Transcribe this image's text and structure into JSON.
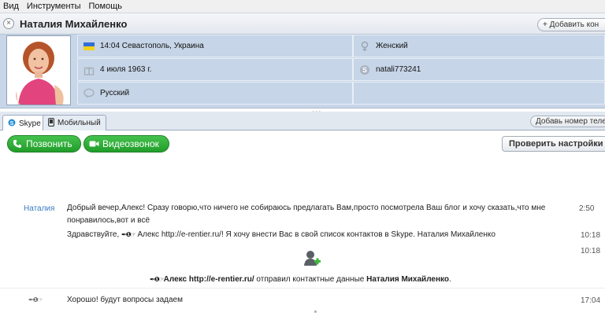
{
  "menu": {
    "items": [
      "Вид",
      "Инструменты",
      "Помощь"
    ]
  },
  "header": {
    "close_symbol": "×",
    "contact_name": "Наталия Михайленко",
    "add_contact_label": "+ Добавить кон"
  },
  "profile": {
    "local_time": "14:04 Севастополь, Украина",
    "birthday": "4 июля 1963 г.",
    "language": "Русский",
    "gender": "Женский",
    "skype_name": "natali773241",
    "flag_colors": {
      "top": "#2f6fd6",
      "bottom": "#f5d21a"
    }
  },
  "tabs": [
    {
      "label": "Skype",
      "icon": "skype-icon",
      "active": true
    },
    {
      "label": "Мобильный",
      "icon": "mobile-phone-icon",
      "active": false
    }
  ],
  "add_phone_label": "Добавь номер теле",
  "toolbar": {
    "call_label": "Позвонить",
    "video_label": "Видеозвонок",
    "check_settings_label": "Проверить настройки",
    "accent": "#2aa233"
  },
  "chat": {
    "messages": [
      {
        "sender": "Наталия",
        "text_line1": "Добрый вечер,Алекс! Сразу говорю,что ничего не собираюсь предлагать Вам,просто посмотрела Ваш блог и хочу сказать,что мне",
        "text_line2": "понравилось,вот и всё",
        "time": "2:50"
      },
      {
        "text_prefix": "Здравствуйте, ",
        "nick": "✒❶☞",
        "text_rest": " Алекс http://e-rentier.ru/! Я хочу внести Вас в свой список контактов в Skype. Наталия Михайленко",
        "time": "10:18"
      },
      {
        "time": "10:18",
        "nick": "✒❶☞",
        "sender_bold": "Алекс http://e-rentier.ru/",
        "middle": " отправил контактные данные ",
        "contact_bold": "Наталия Михайленко",
        "end": "."
      },
      {
        "sender_nick": "✒❶☞",
        "text": "Хорошо! будут вопросы задаем",
        "time": "17:04"
      }
    ]
  }
}
